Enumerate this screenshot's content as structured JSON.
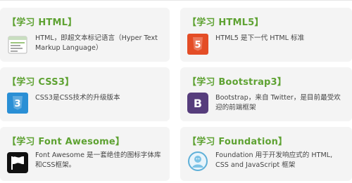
{
  "cards": [
    {
      "title": "【学习 HTML】",
      "icon": "html-document-icon",
      "desc": "HTML，即超文本标记语言（Hyper Text Markup Language）"
    },
    {
      "title": "【学习 HTML5】",
      "icon": "html5-shield-icon",
      "desc": "HTML5 是下一代 HTML 标准"
    },
    {
      "title": "【学习 CSS3】",
      "icon": "css3-shield-icon",
      "desc": "CSS3是CSS技术的升级版本"
    },
    {
      "title": "【学习 Bootstrap3】",
      "icon": "bootstrap-icon",
      "desc": "Bootstrap，来自 Twitter，是目前最受欢迎的前端框架"
    },
    {
      "title": "【学习 Font Awesome】",
      "icon": "font-awesome-flag-icon",
      "desc": "Font Awesome 是一套绝佳的图标字体库和CSS框架。"
    },
    {
      "title": "【学习 Foundation】",
      "icon": "foundation-logo-icon",
      "desc": "Foundation 用于开发响应式的 HTML, CSS and JavaScript 框架"
    }
  ],
  "icon_labels": {
    "html5": "5",
    "css3": "3",
    "bootstrap": "B"
  },
  "colors": {
    "title_green": "#5ea232",
    "card_bg": "#f4f4f4",
    "html5_orange": "#e44d26",
    "css3_blue": "#2a8fd5",
    "bootstrap_purple": "#563d7c"
  }
}
